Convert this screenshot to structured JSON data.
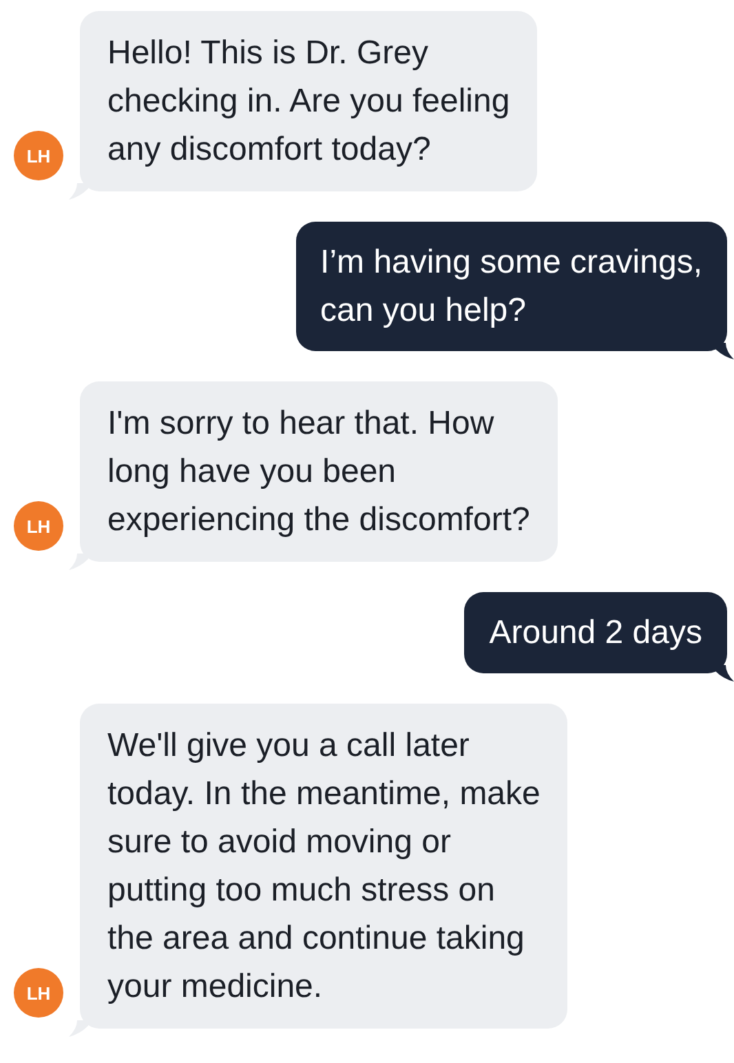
{
  "messages": [
    {
      "kind": "incoming",
      "avatar": "LH",
      "text": "Hello! This is Dr. Grey\nchecking in. Are you feeling\nany discomfort today?"
    },
    {
      "kind": "outgoing",
      "text": "I’m having some cravings,\ncan you help?"
    },
    {
      "kind": "incoming",
      "avatar": "LH",
      "text": "I'm sorry to hear that. How\nlong have you been\nexperiencing the discomfort?"
    },
    {
      "kind": "outgoing",
      "text": "Around 2 days"
    },
    {
      "kind": "incoming",
      "avatar": "LH",
      "text": "We'll give you a call later\ntoday. In the meantime, make\nsure to avoid moving or\nputting too much stress on\nthe area and continue taking\nyour medicine."
    }
  ]
}
